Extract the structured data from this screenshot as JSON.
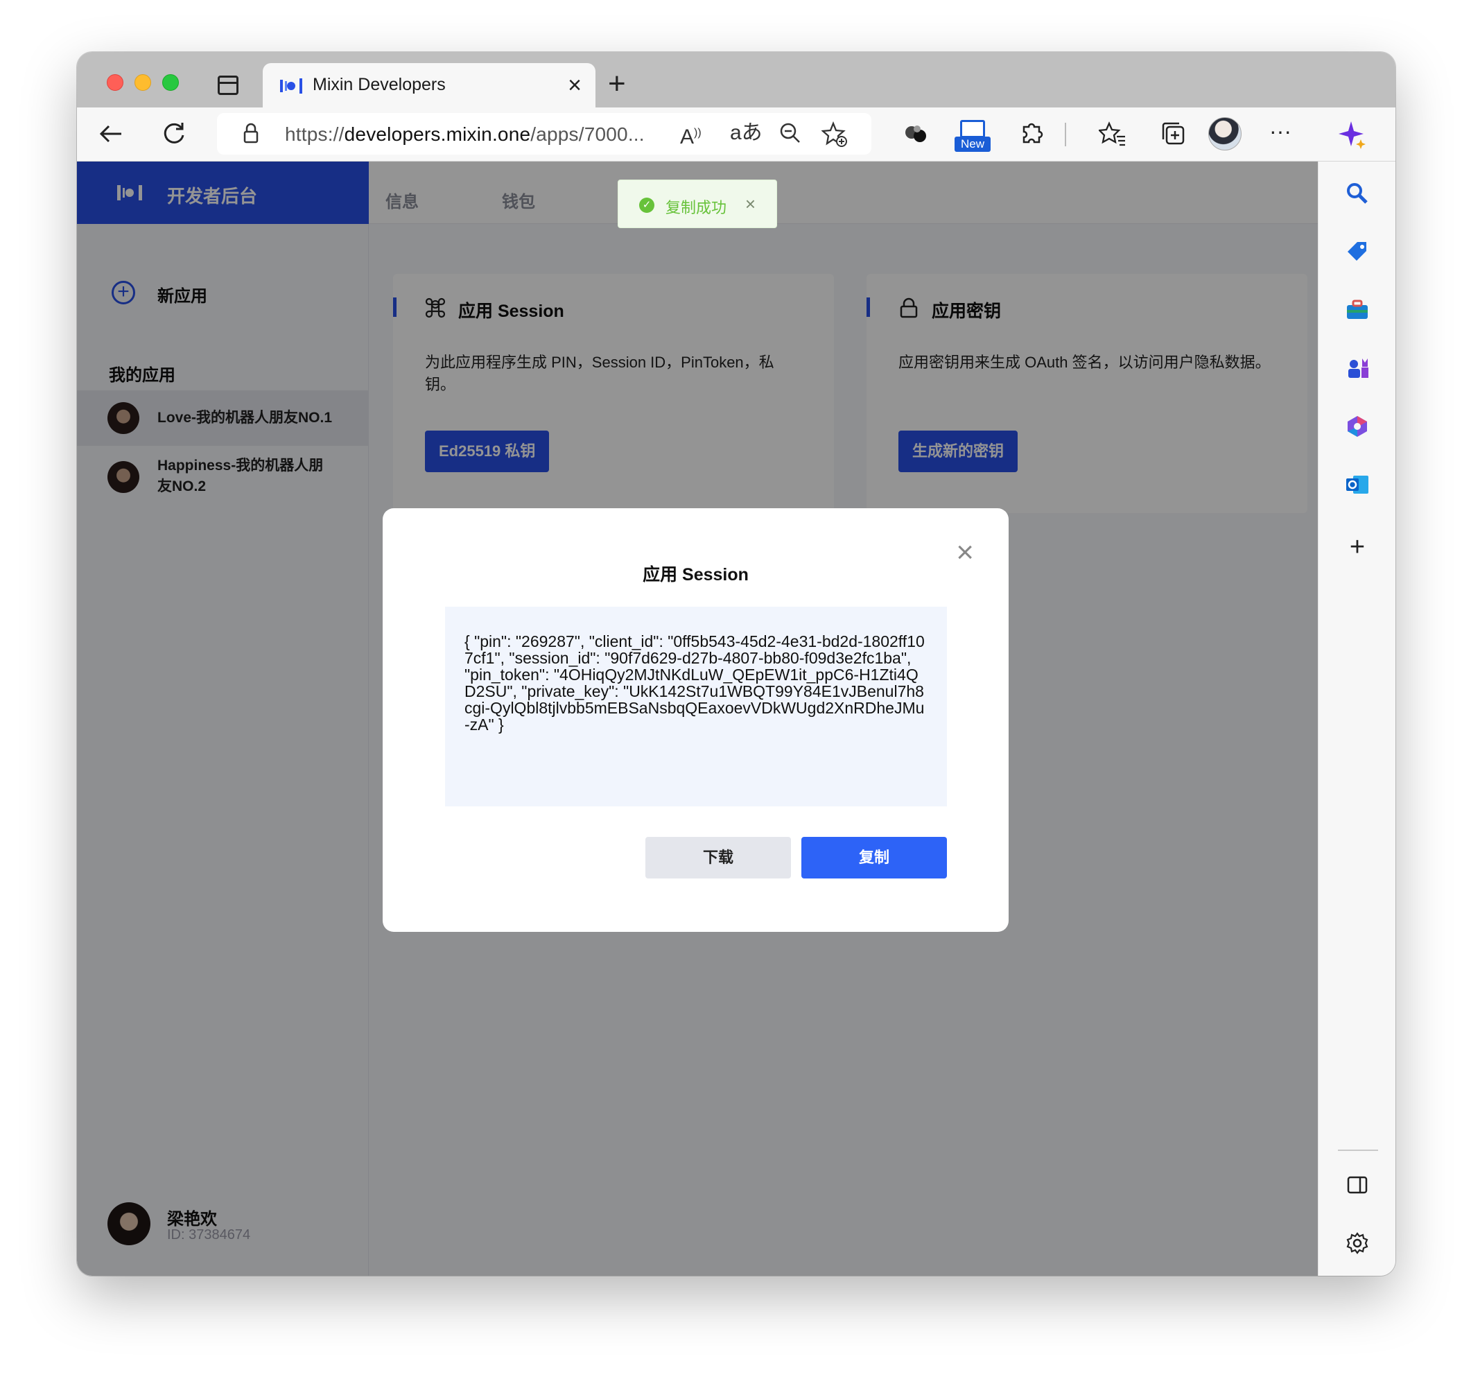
{
  "browser": {
    "tab_title": "Mixin Developers",
    "url_prefix": "https://",
    "url_host": "developers.mixin.one",
    "url_path": "/apps/7000...",
    "new_badge": "New"
  },
  "app": {
    "brand_title": "开发者后台",
    "new_app_label": "新应用",
    "my_apps_title": "我的应用",
    "apps": [
      {
        "name": "Love-我的机器人朋友NO.1",
        "active": true
      },
      {
        "name": "Happiness-我的机器人朋友NO.2",
        "active": false
      }
    ],
    "user": {
      "name": "梁艳欢",
      "id": "ID: 37384674"
    },
    "tabs": [
      "信息",
      "钱包"
    ],
    "cards": [
      {
        "title": "应用 Session",
        "desc": "为此应用程序生成 PIN，Session ID，PinToken，私钥。",
        "button": "Ed25519 私钥"
      },
      {
        "title": "应用密钥",
        "desc": "应用密钥用来生成 OAuth 签名，以访问用户隐私数据。",
        "button": "生成新的密钥"
      }
    ]
  },
  "toast": {
    "text": "复制成功"
  },
  "modal": {
    "title": "应用 Session",
    "content": "{ \"pin\": \"269287\", \"client_id\": \"0ff5b543-45d2-4e31-bd2d-1802ff107cf1\", \"session_id\": \"90f7d629-d27b-4807-bb80-f09d3e2fc1ba\", \"pin_token\": \"4OHiqQy2MJtNKdLuW_QEpEW1it_ppC6-H1Zti4QD2SU\", \"private_key\": \"UkK142St7u1WBQT99Y84E1vJBenul7h8cgi-QylQbl8tjlvbb5mEBSaNsbqQEaxoevVDkWUgd2XnRDheJMu-zA\" }",
    "download_label": "下载",
    "copy_label": "复制"
  },
  "colors": {
    "brand_blue": "#2950e6",
    "copy_blue": "#2d63f7",
    "toast_green": "#67c23a"
  }
}
